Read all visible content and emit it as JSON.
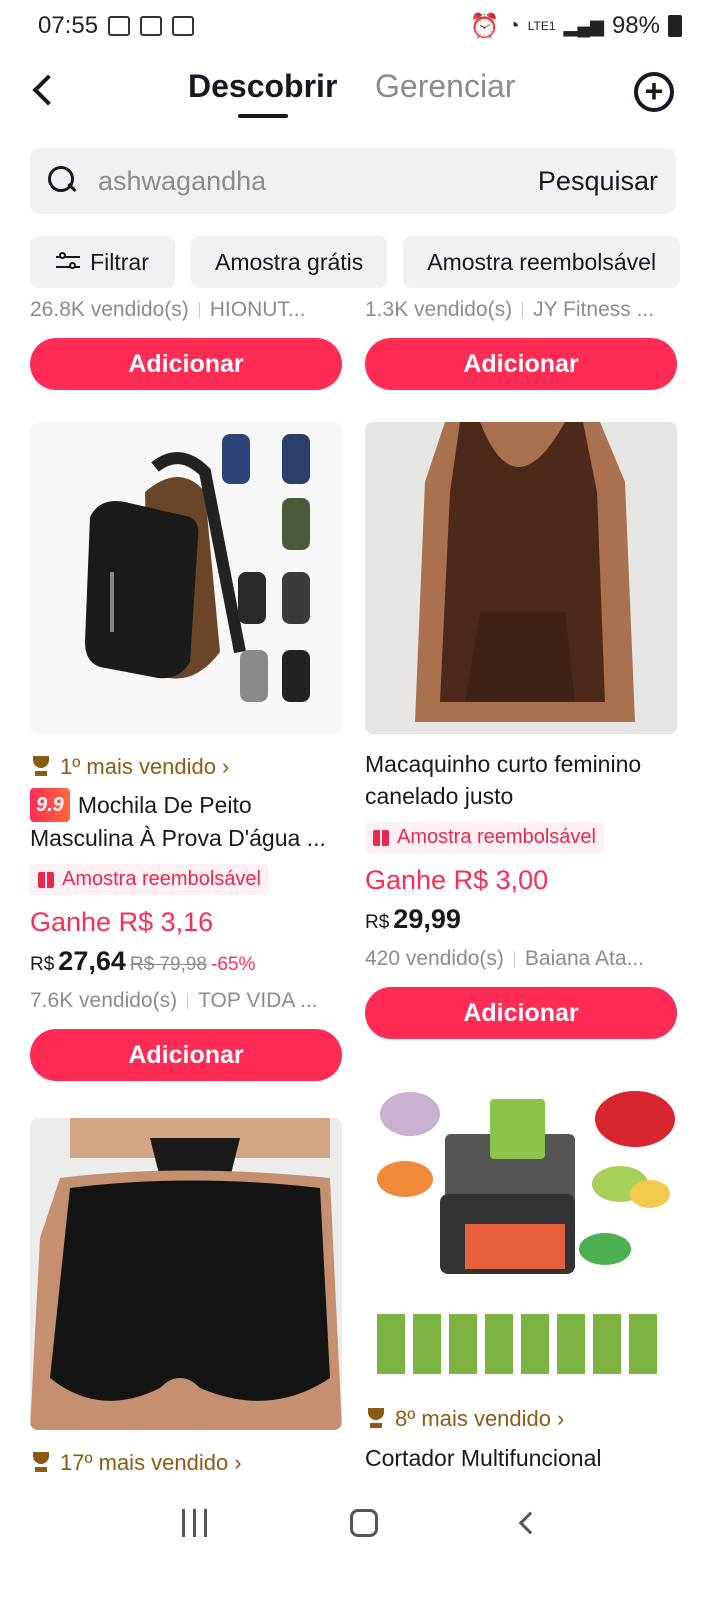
{
  "status_bar": {
    "time": "07:55",
    "battery": "98%",
    "network": "LTE1"
  },
  "header": {
    "tab_discover": "Descobrir",
    "tab_manage": "Gerenciar"
  },
  "search": {
    "placeholder": "ashwagandha",
    "button": "Pesquisar"
  },
  "filters": [
    {
      "label": "Filtrar"
    },
    {
      "label": "Amostra grátis"
    },
    {
      "label": "Amostra reembolsável"
    }
  ],
  "add_label": "Adicionar",
  "top_row": {
    "left": {
      "sold": "26.8K vendido(s)",
      "shop": "HIONUT..."
    },
    "right": {
      "sold": "1.3K vendido(s)",
      "shop": "JY Fitness ..."
    }
  },
  "products": [
    {
      "rank": "1º mais vendido",
      "badge": "9.9",
      "title": "Mochila De Peito Masculina À Prova D'água ...",
      "tag": "Amostra reembolsável",
      "earn": "Ganhe R$ 3,16",
      "currency": "R$",
      "price": "27,64",
      "old_price": "R$ 79,98",
      "discount": "-65%",
      "sold": "7.6K vendido(s)",
      "shop": "TOP VIDA ..."
    },
    {
      "title": "Macaquinho curto feminino canelado justo",
      "tag": "Amostra reembolsável",
      "earn": "Ganhe R$ 3,00",
      "currency": "R$",
      "price": "29,99",
      "sold": "420 vendido(s)",
      "shop": "Baiana Ata..."
    },
    {
      "rank": "17º mais vendido"
    },
    {
      "rank": "8º mais vendido",
      "title": "Cortador Multifuncional"
    }
  ],
  "colors": {
    "accent": "#fe2c55",
    "rank": "#8b5a13"
  }
}
